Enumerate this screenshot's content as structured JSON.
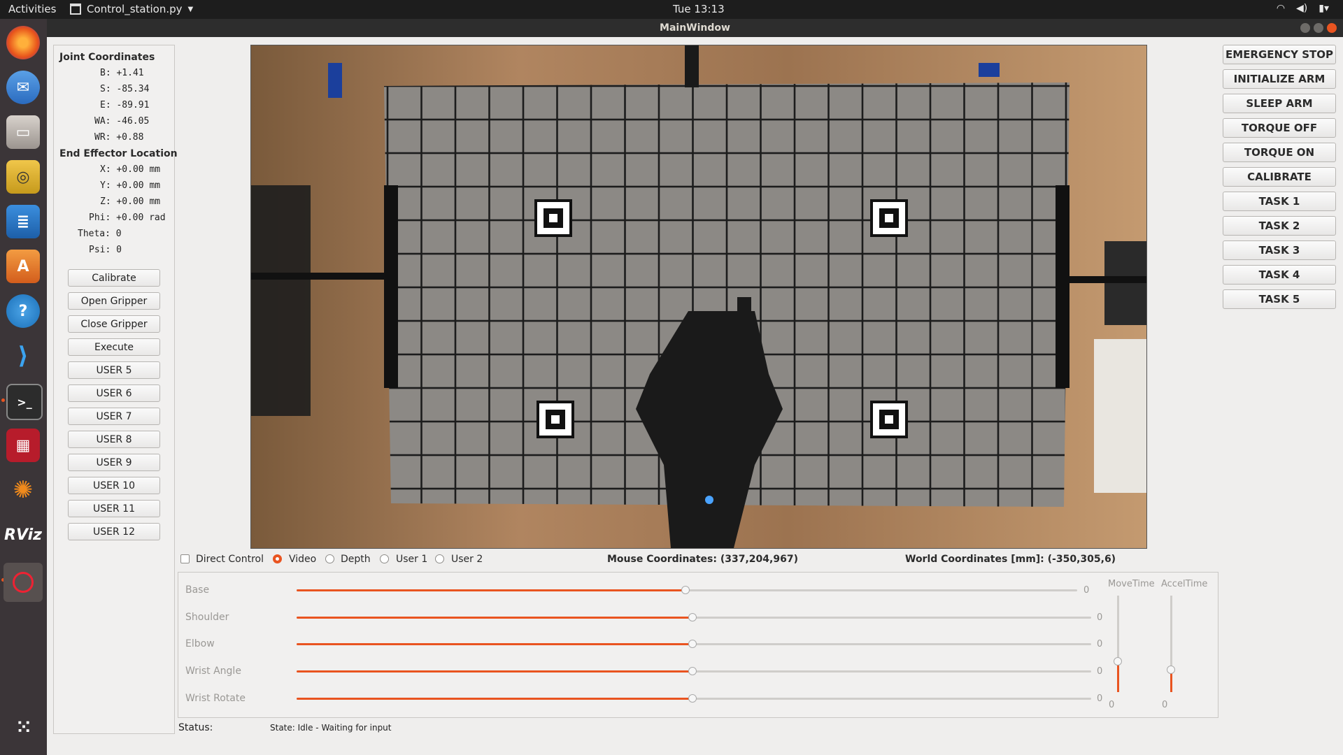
{
  "topbar": {
    "activities": "Activities",
    "app_name": "Control_station.py",
    "clock": "Tue 13:13"
  },
  "window": {
    "title": "MainWindow"
  },
  "joint": {
    "header": "Joint Coordinates",
    "rows": [
      "B: +1.41",
      "S: -85.34",
      "E: -89.91",
      "WA: -46.05",
      "WR: +0.88"
    ]
  },
  "ee": {
    "header": "End Effector Location",
    "rows": [
      "X: +0.00 mm",
      "Y: +0.00 mm",
      "Z: +0.00 mm",
      "Phi: +0.00 rad",
      "Theta: 0",
      "Psi: 0"
    ]
  },
  "left_buttons": [
    "Calibrate",
    "Open Gripper",
    "Close Gripper",
    "Execute",
    "USER 5",
    "USER 6",
    "USER 7",
    "USER 8",
    "USER 9",
    "USER 10",
    "USER 11",
    "USER 12"
  ],
  "right_buttons": [
    "EMERGENCY STOP",
    "INITIALIZE ARM",
    "SLEEP ARM",
    "TORQUE OFF",
    "TORQUE ON",
    "CALIBRATE",
    "TASK 1",
    "TASK 2",
    "TASK 3",
    "TASK 4",
    "TASK 5"
  ],
  "view_row": {
    "direct_control": "Direct Control",
    "radios": [
      "Video",
      "Depth",
      "User 1",
      "User 2"
    ],
    "selected": "Video",
    "mouse_coords": "Mouse Coordinates: (337,204,967)",
    "world_coords": "World Coordinates [mm]: (-350,305,6)"
  },
  "sliders": [
    {
      "label": "Base",
      "value": "0",
      "level": 0.5
    },
    {
      "label": "Shoulder",
      "value": "0",
      "level": 0.5
    },
    {
      "label": "Elbow",
      "value": "0",
      "level": 0.5
    },
    {
      "label": "Wrist Angle",
      "value": "0",
      "level": 0.5
    },
    {
      "label": "Wrist Rotate",
      "value": "0",
      "level": 0.5
    }
  ],
  "vsliders": {
    "move_label": "MoveTime",
    "accel_label": "AccelTime",
    "move_value": "0",
    "accel_value": "0"
  },
  "status": {
    "label": "Status:",
    "text": "State: Idle - Waiting for input"
  },
  "colors": {
    "accent": "#e95420",
    "dock": "#3b3538",
    "topbar": "#1d1d1d"
  }
}
